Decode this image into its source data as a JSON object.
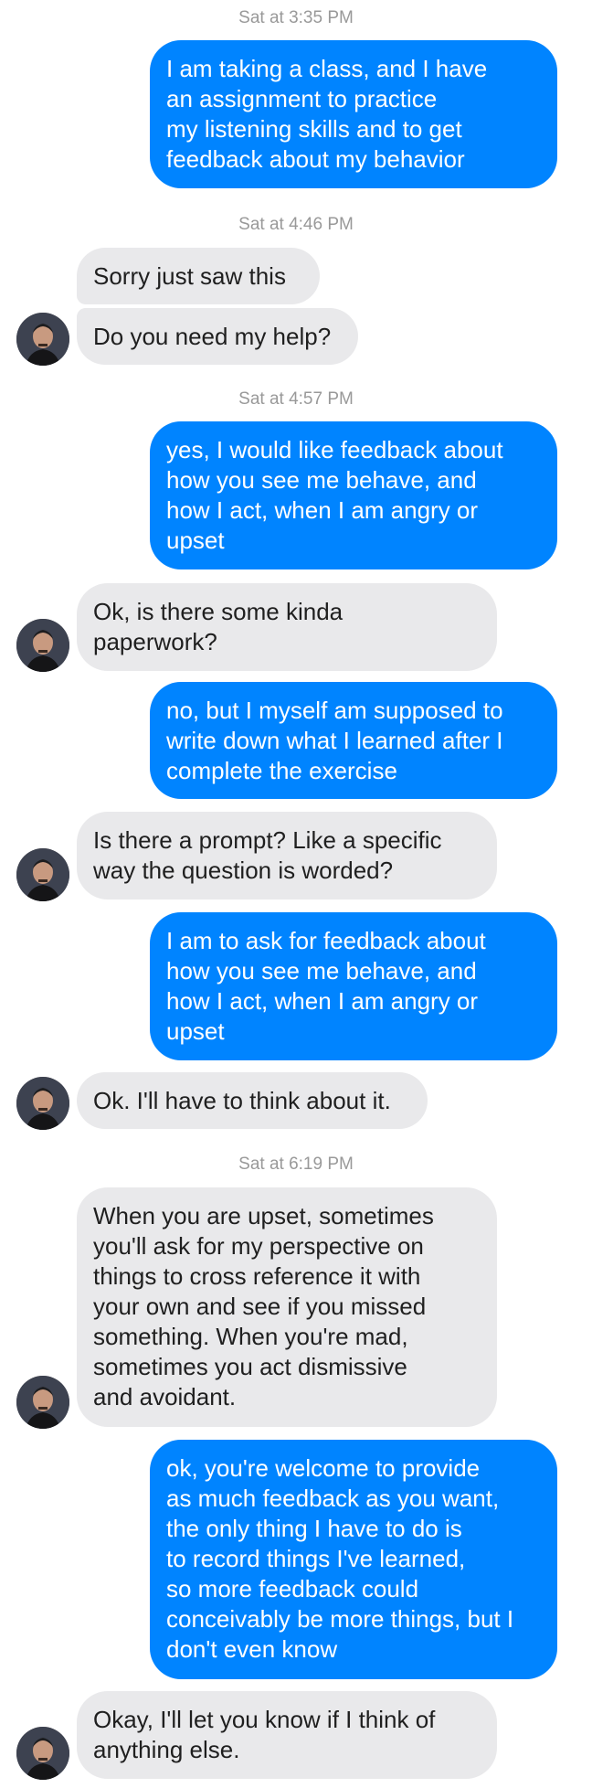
{
  "conversation": {
    "items": [
      {
        "kind": "timestamp",
        "text": "Sat at 3:35 PM"
      },
      {
        "kind": "message",
        "direction": "outgoing",
        "text": "I am taking a class, and I have\nan assignment to practice\nmy listening skills and to get\nfeedback about my behavior"
      },
      {
        "kind": "timestamp",
        "text": "Sat at 4:46 PM"
      },
      {
        "kind": "message",
        "direction": "incoming",
        "text": "Sorry just saw this"
      },
      {
        "kind": "message",
        "direction": "incoming",
        "text": "Do you need my help?",
        "avatar": true
      },
      {
        "kind": "timestamp",
        "text": "Sat at 4:57 PM"
      },
      {
        "kind": "message",
        "direction": "outgoing",
        "text": "yes, I would like feedback about\nhow you see me behave, and\nhow I act, when I am angry or\nupset"
      },
      {
        "kind": "message",
        "direction": "incoming",
        "text": "Ok, is there some kinda\npaperwork?",
        "avatar": true
      },
      {
        "kind": "message",
        "direction": "outgoing",
        "text": "no, but I myself am supposed to\nwrite down what I learned after I\ncomplete the exercise"
      },
      {
        "kind": "message",
        "direction": "incoming",
        "text": "Is there a prompt? Like a specific\nway the question is worded?",
        "avatar": true
      },
      {
        "kind": "message",
        "direction": "outgoing",
        "text": "I am to ask for feedback about\nhow you see me behave, and\nhow I act, when I am angry or\nupset"
      },
      {
        "kind": "message",
        "direction": "incoming",
        "text": "Ok. I'll have to think about it.",
        "avatar": true
      },
      {
        "kind": "timestamp",
        "text": "Sat at 6:19 PM"
      },
      {
        "kind": "message",
        "direction": "incoming",
        "text": "When you are upset, sometimes\nyou'll ask for my perspective on\nthings to cross reference it with\nyour own and see if you missed\nsomething. When you're mad,\nsometimes you act dismissive\nand avoidant.",
        "avatar": true
      },
      {
        "kind": "message",
        "direction": "outgoing",
        "text": "ok, you're welcome to provide\nas much feedback as you want,\nthe only thing I have to do is\nto record things I've learned,\nso more feedback could\nconceivably be more things, but I\ndon't even know"
      },
      {
        "kind": "message",
        "direction": "incoming",
        "text": "Okay, I'll let you know if I think of\nanything else.",
        "avatar": true
      }
    ]
  },
  "colors": {
    "outgoing_bubble": "#0084ff",
    "incoming_bubble": "#e9e9eb",
    "timestamp_text": "#999999"
  },
  "icons": {
    "avatar": "contact-avatar-icon"
  }
}
